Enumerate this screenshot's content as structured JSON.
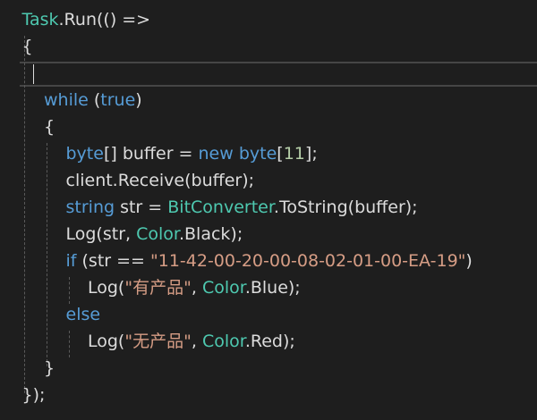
{
  "editor": {
    "colors": {
      "background": "#1e1e1e",
      "default": "#dcdcdc",
      "keyword": "#569cd6",
      "type": "#4ec9b0",
      "string": "#d69d85",
      "number": "#b5cea8",
      "current_line_border": "#464646",
      "indent_guide": "#5a5a5a"
    },
    "lines": [
      {
        "indent": 1,
        "tokens": [
          {
            "t": "Task",
            "k": "type"
          },
          {
            "t": ".Run(() =>",
            "k": "default"
          }
        ]
      },
      {
        "indent": 1,
        "tokens": [
          {
            "t": "{",
            "k": "default"
          }
        ]
      },
      {
        "indent": 1,
        "tokens": []
      },
      {
        "indent": 2,
        "tokens": [
          {
            "t": "while",
            "k": "keyword"
          },
          {
            "t": " (",
            "k": "default"
          },
          {
            "t": "true",
            "k": "keyword"
          },
          {
            "t": ")",
            "k": "default"
          }
        ]
      },
      {
        "indent": 2,
        "tokens": [
          {
            "t": "{",
            "k": "default"
          }
        ]
      },
      {
        "indent": 3,
        "tokens": [
          {
            "t": "byte",
            "k": "keyword"
          },
          {
            "t": "[] buffer = ",
            "k": "default"
          },
          {
            "t": "new",
            "k": "keyword"
          },
          {
            "t": " ",
            "k": "default"
          },
          {
            "t": "byte",
            "k": "keyword"
          },
          {
            "t": "[",
            "k": "default"
          },
          {
            "t": "11",
            "k": "number"
          },
          {
            "t": "];",
            "k": "default"
          }
        ]
      },
      {
        "indent": 3,
        "tokens": [
          {
            "t": "client.Receive(buffer);",
            "k": "default"
          }
        ]
      },
      {
        "indent": 3,
        "tokens": [
          {
            "t": "string",
            "k": "keyword"
          },
          {
            "t": " str = ",
            "k": "default"
          },
          {
            "t": "BitConverter",
            "k": "type"
          },
          {
            "t": ".ToString(buffer);",
            "k": "default"
          }
        ]
      },
      {
        "indent": 3,
        "tokens": [
          {
            "t": "Log(str, ",
            "k": "default"
          },
          {
            "t": "Color",
            "k": "type"
          },
          {
            "t": ".Black);",
            "k": "default"
          }
        ]
      },
      {
        "indent": 3,
        "tokens": [
          {
            "t": "if",
            "k": "keyword"
          },
          {
            "t": " (str == ",
            "k": "default"
          },
          {
            "t": "\"11-42-00-20-00-08-02-01-00-EA-19\"",
            "k": "string"
          },
          {
            "t": ")",
            "k": "default"
          }
        ]
      },
      {
        "indent": 4,
        "tokens": [
          {
            "t": "Log(",
            "k": "default"
          },
          {
            "t": "\"有产品\"",
            "k": "string"
          },
          {
            "t": ", ",
            "k": "default"
          },
          {
            "t": "Color",
            "k": "type"
          },
          {
            "t": ".Blue);",
            "k": "default"
          }
        ]
      },
      {
        "indent": 3,
        "tokens": [
          {
            "t": "else",
            "k": "keyword"
          }
        ]
      },
      {
        "indent": 4,
        "tokens": [
          {
            "t": "Log(",
            "k": "default"
          },
          {
            "t": "\"无产品\"",
            "k": "string"
          },
          {
            "t": ", ",
            "k": "default"
          },
          {
            "t": "Color",
            "k": "type"
          },
          {
            "t": ".Red);",
            "k": "default"
          }
        ]
      },
      {
        "indent": 2,
        "tokens": [
          {
            "t": "}",
            "k": "default"
          }
        ]
      },
      {
        "indent": 1,
        "tokens": [
          {
            "t": "});",
            "k": "default"
          }
        ]
      }
    ]
  }
}
